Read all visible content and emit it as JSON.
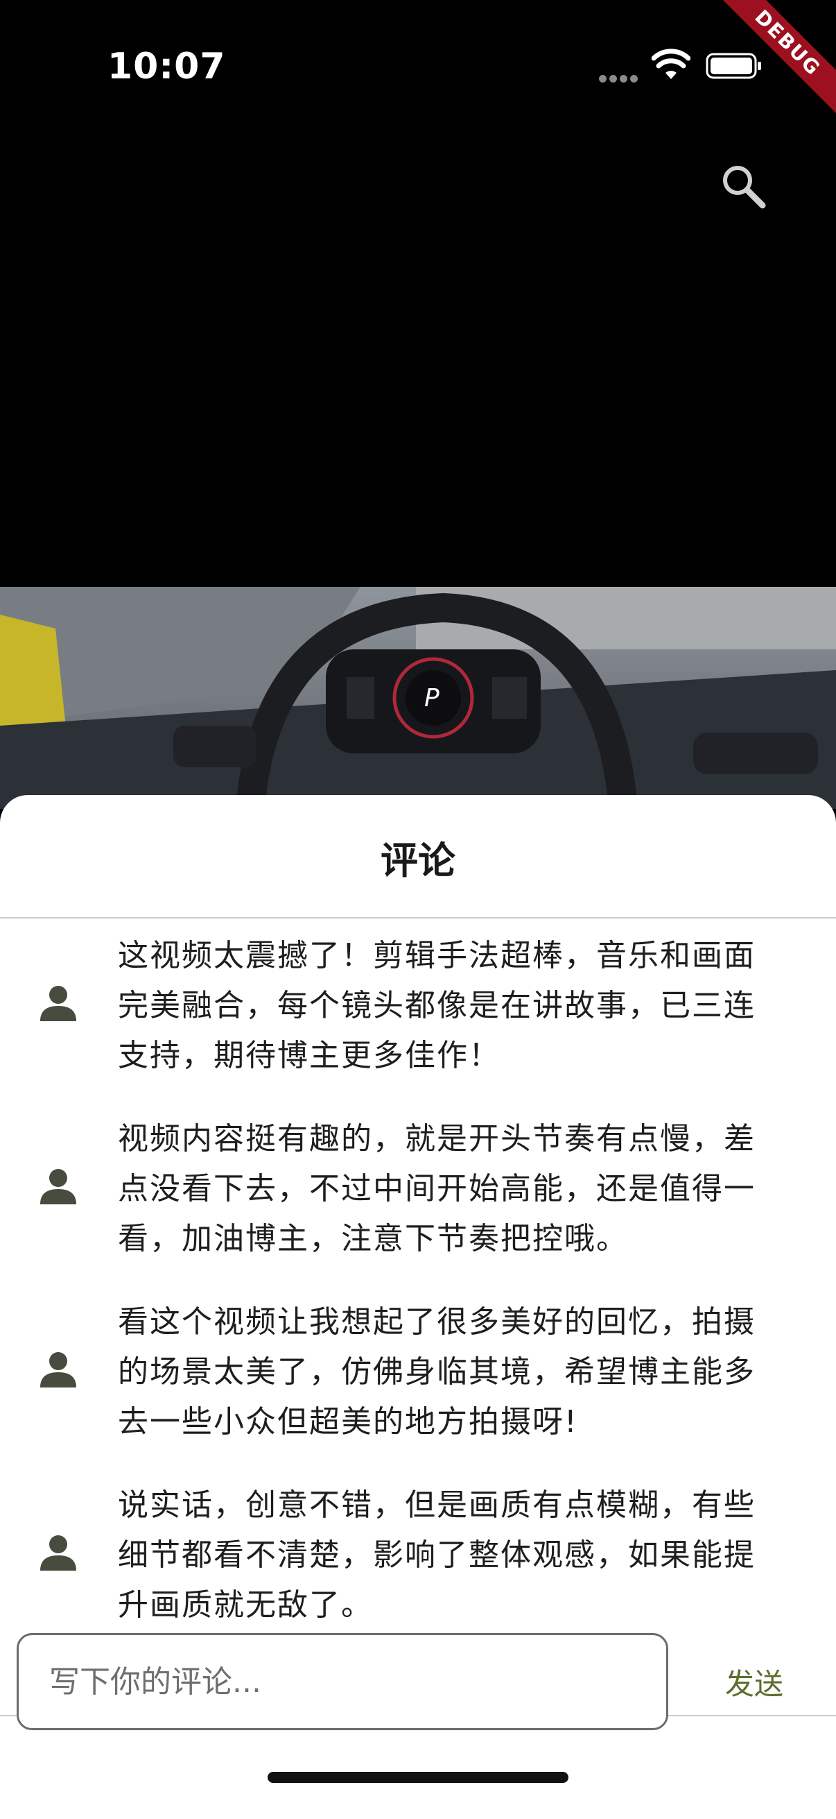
{
  "status_bar": {
    "time": "10:07",
    "debug_label": "DEBUG"
  },
  "header": {
    "search_icon": "search-icon"
  },
  "sheet": {
    "title": "评论",
    "comments": [
      {
        "avatar_icon": "person-icon",
        "text": "这视频太震撼了！剪辑手法超棒，音乐和画面完美融合，每个镜头都像是在讲故事，已三连支持，期待博主更多佳作！"
      },
      {
        "avatar_icon": "person-icon",
        "text": "视频内容挺有趣的，就是开头节奏有点慢，差点没看下去，不过中间开始高能，还是值得一看，加油博主，注意下节奏把控哦。"
      },
      {
        "avatar_icon": "person-icon",
        "text": "看这个视频让我想起了很多美好的回忆，拍摄的场景太美了，仿佛身临其境，希望博主能多去一些小众但超美的地方拍摄呀!"
      },
      {
        "avatar_icon": "person-icon",
        "text": "说实话，创意不错，但是画质有点模糊，有些细节都看不清楚，影响了整体观感，如果能提升画质就无敌了。"
      }
    ],
    "input": {
      "placeholder": "写下你的评论...",
      "value": ""
    },
    "send_label": "发送"
  },
  "colors": {
    "accent": "#5a6e2e",
    "debug_ribbon": "#9c1020"
  }
}
